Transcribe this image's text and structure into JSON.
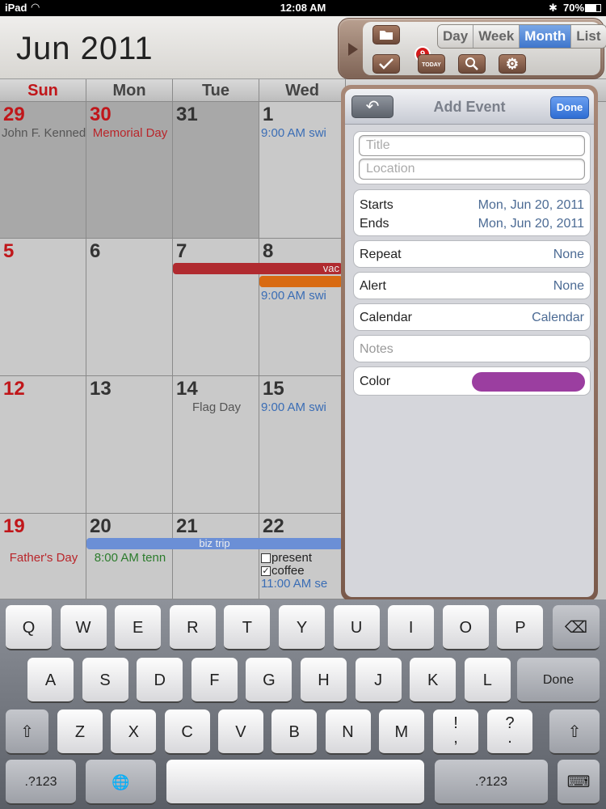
{
  "status": {
    "device": "iPad",
    "time": "12:08 AM",
    "battery": "70%"
  },
  "header": {
    "month_title": "Jun 2011",
    "views": [
      "Day",
      "Week",
      "Month",
      "List"
    ],
    "active_view": "Month",
    "tasks_badge": "9",
    "today_label": "TODAY"
  },
  "calendar": {
    "weekdays": [
      "Sun",
      "Mon",
      "Tue",
      "Wed"
    ],
    "weeks": [
      [
        {
          "day": "29",
          "other": true,
          "red": true,
          "events": [
            {
              "text": "John F. Kenned",
              "style": "gray"
            }
          ]
        },
        {
          "day": "30",
          "other": true,
          "red": true,
          "events": [
            {
              "text": "Memorial Day",
              "style": "red"
            }
          ]
        },
        {
          "day": "31",
          "other": true,
          "events": []
        },
        {
          "day": "1",
          "events": [
            {
              "text": "9:00 AM swi",
              "style": "blue"
            }
          ]
        }
      ],
      [
        {
          "day": "5",
          "red": true,
          "events": []
        },
        {
          "day": "6",
          "events": []
        },
        {
          "day": "7",
          "events": []
        },
        {
          "day": "8",
          "events": [
            {
              "text": "9:00 AM swi",
              "style": "blue"
            }
          ]
        }
      ],
      [
        {
          "day": "12",
          "red": true,
          "events": []
        },
        {
          "day": "13",
          "events": []
        },
        {
          "day": "14",
          "events": [
            {
              "text": "Flag Day",
              "style": "gray"
            }
          ]
        },
        {
          "day": "15",
          "events": [
            {
              "text": "9:00 AM swi",
              "style": "blue"
            }
          ]
        }
      ],
      [
        {
          "day": "19",
          "red": true,
          "events": [
            {
              "text": "Father's Day",
              "style": "red"
            }
          ]
        },
        {
          "day": "20",
          "events": [
            {
              "text": "8:00 AM tenn",
              "style": "green"
            }
          ]
        },
        {
          "day": "21",
          "events": []
        },
        {
          "day": "22",
          "events": [
            {
              "text": "present",
              "style": "task"
            },
            {
              "text": "coffee",
              "style": "taskdone"
            },
            {
              "text": "11:00 AM se",
              "style": "blue"
            }
          ]
        }
      ]
    ],
    "multi_day_bars": [
      {
        "label": "vac",
        "color": "#b02a2f"
      },
      {
        "label": "",
        "color": "#d86a12"
      },
      {
        "label": "biz trip",
        "color": "#6b8fd6"
      }
    ]
  },
  "popover": {
    "title": "Add Event",
    "done_label": "Done",
    "title_placeholder": "Title",
    "location_placeholder": "Location",
    "starts_label": "Starts",
    "starts_value": "Mon, Jun 20, 2011",
    "ends_label": "Ends",
    "ends_value": "Mon, Jun 20, 2011",
    "repeat_label": "Repeat",
    "repeat_value": "None",
    "alert_label": "Alert",
    "alert_value": "None",
    "calendar_label": "Calendar",
    "calendar_value": "Calendar",
    "notes_placeholder": "Notes",
    "color_label": "Color",
    "color_value": "#9b3ea0"
  },
  "keyboard": {
    "row1": [
      "Q",
      "W",
      "E",
      "R",
      "T",
      "Y",
      "U",
      "I",
      "O",
      "P"
    ],
    "row2": [
      "A",
      "S",
      "D",
      "F",
      "G",
      "H",
      "J",
      "K",
      "L"
    ],
    "row3": [
      "Z",
      "X",
      "C",
      "V",
      "B",
      "N",
      "M"
    ],
    "return_label": "Done",
    "numbers_label": ".?123",
    "punct1_top": "!",
    "punct1_bottom": ",",
    "punct2_top": "?",
    "punct2_bottom": "."
  }
}
